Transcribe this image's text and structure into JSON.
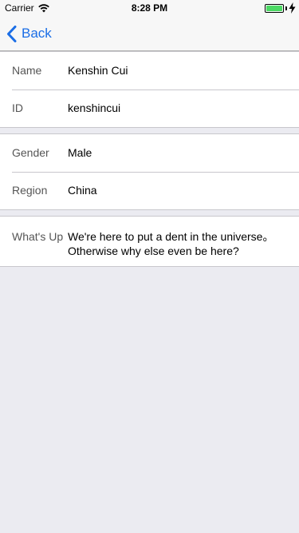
{
  "status_bar": {
    "carrier": "Carrier",
    "time": "8:28 PM",
    "battery_color": "#4CD964"
  },
  "nav": {
    "back_label": "Back",
    "accent_color": "#1B6EE6"
  },
  "sections": [
    {
      "rows": [
        {
          "label": "Name",
          "value": "Kenshin Cui"
        },
        {
          "label": "ID",
          "value": "kenshincui"
        }
      ]
    },
    {
      "rows": [
        {
          "label": "Gender",
          "value": "Male"
        },
        {
          "label": "Region",
          "value": "China"
        }
      ]
    },
    {
      "rows": [
        {
          "label": "What's Up",
          "value": "We're here to put a dent in the universe。Otherwise why else even be here?"
        }
      ]
    }
  ]
}
